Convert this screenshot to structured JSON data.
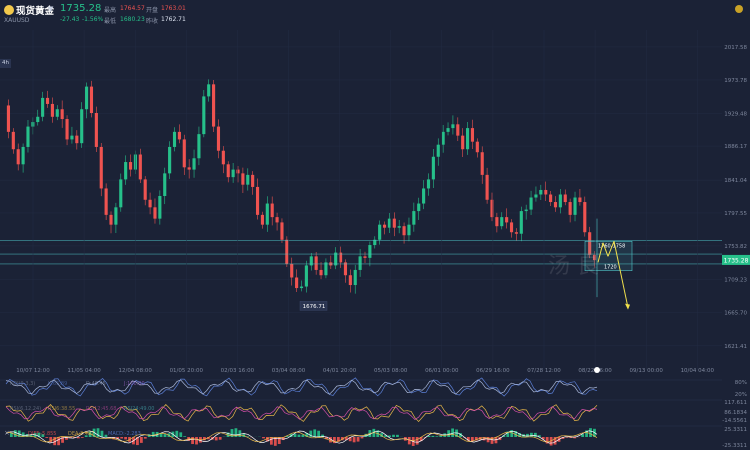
{
  "header": {
    "symbol_name": "现货黄金",
    "symbol_code": "XAUUSD",
    "price": "1735.28",
    "change_abs": "-27.43",
    "change_pct": "-1.56%",
    "high_label": "最高",
    "high_value": "1764.57",
    "open_label": "开盘",
    "open_value": "1763.01",
    "low_label": "最低",
    "low_value": "1680.23",
    "prev_close_label": "昨收",
    "prev_close_value": "1762.71",
    "period": "4h"
  },
  "colors": {
    "background": "#1b2236",
    "up": "#26c08a",
    "down": "#ef5350",
    "annotation": "#4fc3c6",
    "arrow": "#f2e14c"
  },
  "chart_data": [
    {
      "type": "line",
      "name": "price",
      "x_ticks": [
        "10/07 12:00",
        "11/05 04:00",
        "12/04 08:00",
        "01/05 20:00",
        "02/03 16:00",
        "03/04 08:00",
        "04/01 20:00",
        "05/03 08:00",
        "06/01 00:00",
        "06/29 16:00",
        "07/28 12:00",
        "08/22 16:00",
        "09/13 00:00",
        "10/04 04:00"
      ],
      "y_ticks": [
        "2017.58",
        "1973.78",
        "1929.48",
        "1886.17",
        "1841.04",
        "1797.55",
        "1753.82",
        "1709.23",
        "1665.70",
        "1621.41"
      ],
      "ylim": [
        1600,
        2040
      ],
      "current_price": "1735.28",
      "low_label": "1676.71",
      "box_label_top": "1760-1758",
      "box_label_bottom": "1720",
      "watermark": "汤 良",
      "levels": [
        1761,
        1743,
        1730
      ],
      "values": [
        1940,
        1905,
        1882,
        1862,
        1885,
        1912,
        1918,
        1925,
        1950,
        1942,
        1925,
        1935,
        1922,
        1895,
        1900,
        1890,
        1935,
        1965,
        1930,
        1885,
        1830,
        1795,
        1782,
        1805,
        1842,
        1865,
        1855,
        1875,
        1842,
        1815,
        1805,
        1790,
        1820,
        1850,
        1885,
        1905,
        1895,
        1858,
        1855,
        1870,
        1902,
        1952,
        1968,
        1912,
        1880,
        1862,
        1845,
        1855,
        1850,
        1835,
        1848,
        1832,
        1795,
        1782,
        1810,
        1792,
        1785,
        1762,
        1730,
        1712,
        1698,
        1700,
        1728,
        1740,
        1722,
        1715,
        1732,
        1728,
        1745,
        1732,
        1715,
        1702,
        1722,
        1740,
        1738,
        1755,
        1762,
        1782,
        1778,
        1790,
        1778,
        1780,
        1768,
        1782,
        1800,
        1810,
        1830,
        1842,
        1872,
        1888,
        1905,
        1910,
        1915,
        1900,
        1882,
        1910,
        1892,
        1878,
        1848,
        1815,
        1792,
        1780,
        1792,
        1785,
        1772,
        1770,
        1800,
        1802,
        1818,
        1822,
        1828,
        1822,
        1812,
        1805,
        1822,
        1812,
        1795,
        1818,
        1812,
        1772,
        1742,
        1735
      ]
    },
    {
      "type": "line",
      "name": "KDJ",
      "legend": [
        "KDJ(9,3,3)",
        "K:65.89",
        "D:48.45",
        "J:100.00"
      ],
      "y_ticks": [
        "80%",
        "20%"
      ],
      "ylim": [
        0,
        100
      ]
    },
    {
      "type": "line",
      "name": "RSI",
      "legend": [
        "RSI(6,12,24)",
        "RSI6:38.55",
        "RSI12:45.68",
        "RSI24:49.00"
      ],
      "y_ticks": [
        "117.611",
        "86.1834",
        "-14.5561"
      ]
    },
    {
      "type": "bar",
      "name": "MACD",
      "legend": [
        "DIFF:-5.855",
        "DEA:2.427",
        "MACD:-2.283"
      ],
      "y_ticks": [
        "25.3311",
        "-25.3311"
      ],
      "ylim": [
        -26,
        26
      ]
    }
  ]
}
